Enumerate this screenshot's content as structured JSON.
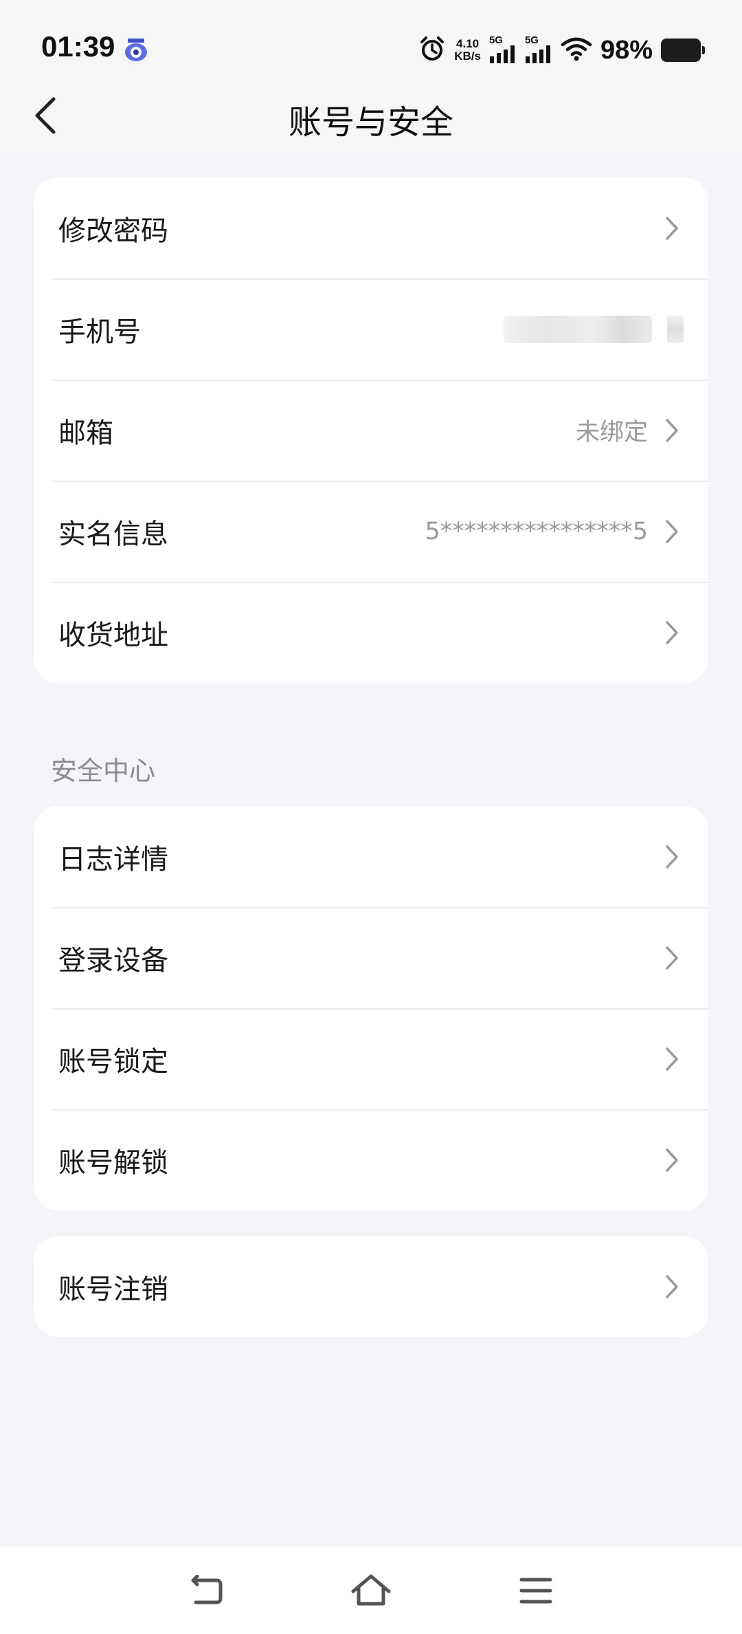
{
  "status_bar": {
    "time": "01:39",
    "net_speed_value": "4.10",
    "net_speed_unit": "KB/s",
    "signal_1_label": "5G",
    "signal_2_label": "5G",
    "battery_percent": "98%",
    "icons": [
      "app-badge-icon",
      "alarm-icon",
      "signal-icon",
      "signal-icon",
      "wifi-icon",
      "battery-icon"
    ]
  },
  "header": {
    "title": "账号与安全",
    "back_icon": "chevron-left-icon"
  },
  "account_card": {
    "items": [
      {
        "label": "修改密码",
        "value": ""
      },
      {
        "label": "手机号",
        "value": ""
      },
      {
        "label": "邮箱",
        "value": "未绑定"
      },
      {
        "label": "实名信息",
        "value": "5****************5"
      },
      {
        "label": "收货地址",
        "value": ""
      }
    ]
  },
  "security_center": {
    "title": "安全中心",
    "items": [
      {
        "label": "日志详情"
      },
      {
        "label": "登录设备"
      },
      {
        "label": "账号锁定"
      },
      {
        "label": "账号解锁"
      }
    ]
  },
  "deactivate_card": {
    "items": [
      {
        "label": "账号注销"
      }
    ]
  },
  "bottom_nav": {
    "icons": [
      "back-nav-icon",
      "home-icon",
      "menu-icon"
    ]
  },
  "colors": {
    "background": "#f3f5f9",
    "card": "#ffffff",
    "secondary_text": "#9a9a9a",
    "chevron": "#9a9a9a"
  }
}
